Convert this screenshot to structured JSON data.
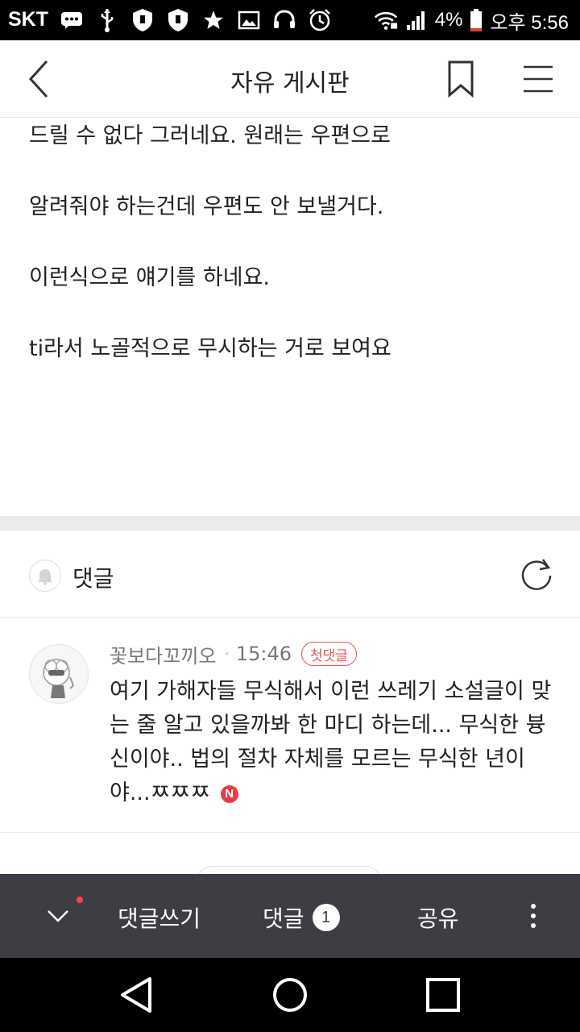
{
  "status_bar": {
    "carrier": "SKT",
    "battery": "4%",
    "time": "오후 5:56",
    "icons": [
      "chat-icon",
      "usb-icon",
      "shield-icon",
      "shield-icon",
      "star-icon",
      "image-icon",
      "headset-icon",
      "alarm-icon",
      "wifi-icon",
      "signal-icon",
      "battery-icon"
    ]
  },
  "header": {
    "title": "자유 게시판"
  },
  "post": {
    "lines": [
      "드릴 수 없다 그러네요. 원래는 우편으로",
      "알려줘야 하는건데 우편도 안 보낼거다.",
      "이런식으로 얘기를 하네요.",
      "ti라서 노골적으로 무시하는 거로 보여요"
    ]
  },
  "comments": {
    "label": "댓글",
    "items": [
      {
        "author": "꽃보다꼬끼오",
        "time": "15:46",
        "badge": "첫댓글",
        "text": "여기 가해자들 무식해서 이런 쓰레기 소설글이 맞는 줄 알고 있을까봐 한 마디 하는데... 무식한 븅신이야.. 법의 절차 자체를 모르는 무식한 년이야...ㅉㅉㅉ",
        "new_badge": "N"
      }
    ]
  },
  "action_bar": {
    "write_label": "댓글쓰기",
    "comments_label": "댓글",
    "comments_count": "1",
    "share_label": "공유"
  },
  "colors": {
    "accent_red": "#ef5050",
    "action_bar_bg": "#3d3e44",
    "section_divider": "#ebebee"
  }
}
